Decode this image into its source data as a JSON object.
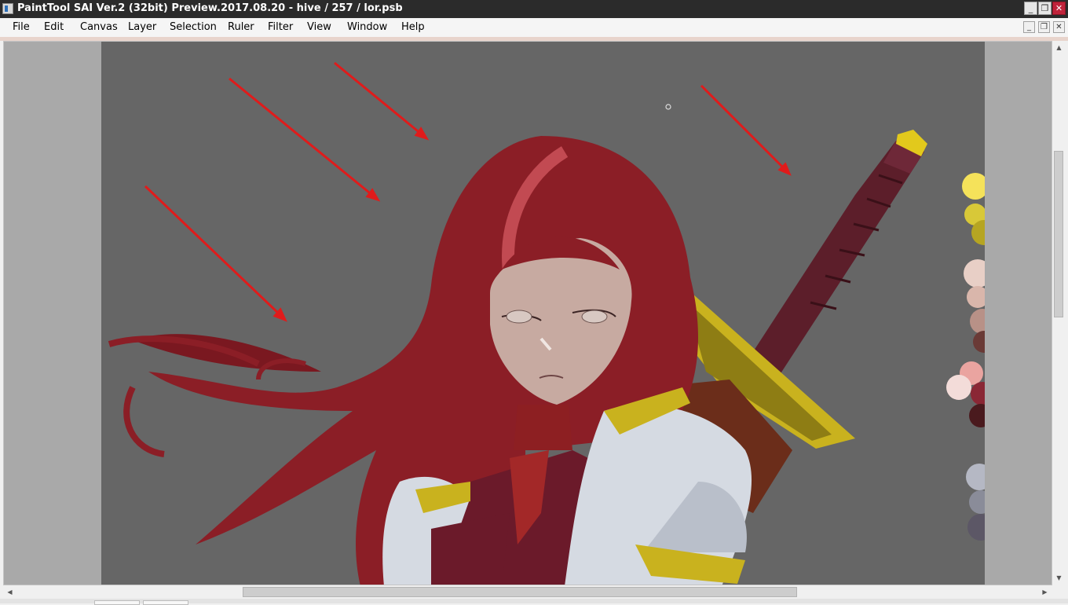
{
  "window": {
    "title": "PaintTool SAI Ver.2 (32bit) Preview.2017.08.20 - hive / 257 / lor.psb",
    "minimize_icon": "minimize-icon",
    "restore_icon": "restore-icon",
    "close_icon": "close-icon"
  },
  "menu": {
    "items": [
      "File",
      "Edit",
      "Canvas",
      "Layer",
      "Selection",
      "Ruler",
      "Filter",
      "View",
      "Window",
      "Help"
    ]
  },
  "canvas": {
    "background_color": "#666666",
    "workspace_color": "#a9a9a9",
    "palette_swatches": [
      "#f5e25a",
      "#d8c838",
      "#b6a522",
      "#e8cfc6",
      "#d9b6ab",
      "#b89187",
      "#6a3a36",
      "#eaa4a0",
      "#f3dcd9",
      "#8a2735",
      "#4a1a1e",
      "#b5b8c4",
      "#8a8c99",
      "#5c5766"
    ]
  },
  "colors": {
    "titlebar": "#2b2b2b",
    "close_button": "#c0233b",
    "hair": "#8b1e26",
    "arrows": "#e01b1b"
  }
}
